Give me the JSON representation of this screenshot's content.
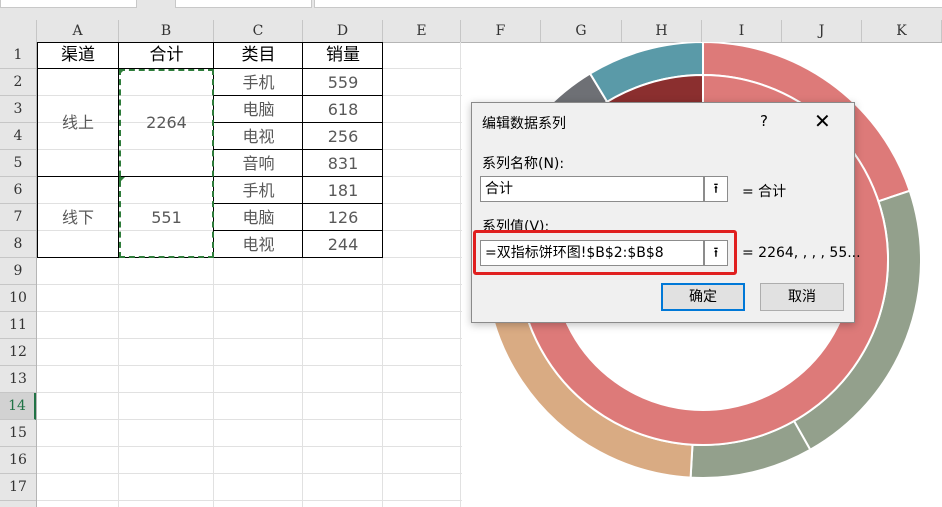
{
  "columns": [
    "A",
    "B",
    "C",
    "D",
    "E",
    "F",
    "G",
    "H",
    "I",
    "J",
    "K"
  ],
  "rows": [
    "1",
    "2",
    "3",
    "4",
    "5",
    "6",
    "7",
    "8",
    "9",
    "10",
    "11",
    "12",
    "13",
    "14",
    "15",
    "16",
    "17"
  ],
  "selected_row": "14",
  "table": {
    "headers": [
      "渠道",
      "合计",
      "类目",
      "销量"
    ],
    "groups": [
      {
        "channel": "线上",
        "total": "2264",
        "items": [
          {
            "category": "手机",
            "sales": "559"
          },
          {
            "category": "电脑",
            "sales": "618"
          },
          {
            "category": "电视",
            "sales": "256"
          },
          {
            "category": "音响",
            "sales": "831"
          }
        ]
      },
      {
        "channel": "线下",
        "total": "551",
        "items": [
          {
            "category": "手机",
            "sales": "181"
          },
          {
            "category": "电脑",
            "sales": "126"
          },
          {
            "category": "电视",
            "sales": "244"
          }
        ]
      }
    ]
  },
  "dialog": {
    "title": "编辑数据系列",
    "help": "?",
    "close": "✕",
    "name_label": "系列名称(N):",
    "name_value": "合计",
    "name_preview": "= 合计",
    "values_label": "系列值(V):",
    "values_value": "=双指标饼环图!$B$2:$B$8",
    "values_preview": "= 2264, , , , 55...",
    "ok": "确定",
    "cancel": "取消",
    "collapse_icon": "collapse-arrow-icon"
  },
  "colors": {
    "accent_green": "#217346",
    "copy_border": "#2f7d3b",
    "highlight_red": "#e02020",
    "outer_pink": "#dd7a79",
    "teal": "#5a9aa8",
    "sage": "#93a08c",
    "tan": "#d9ab83",
    "gray": "#6e7075",
    "dark_red": "#8b2f2f"
  }
}
